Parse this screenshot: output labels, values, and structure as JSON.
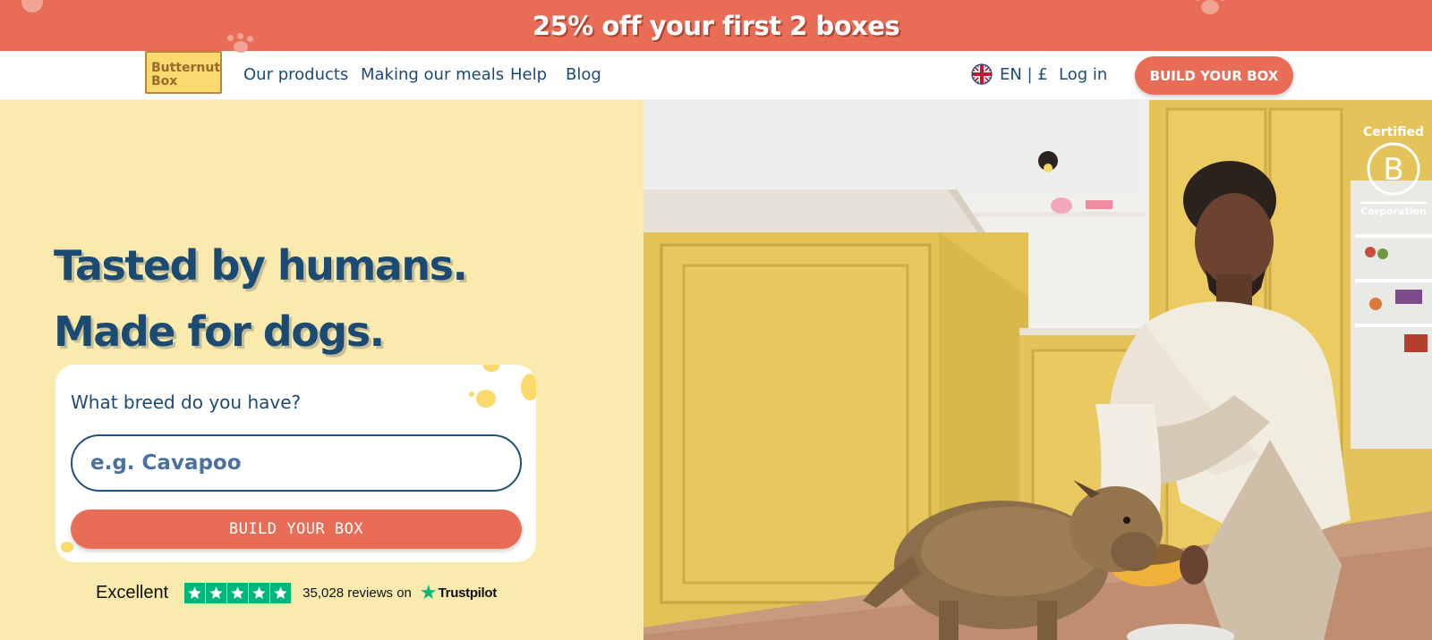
{
  "promo": {
    "text": "25% off your first 2 boxes"
  },
  "nav": {
    "logo_line1": "Butternut",
    "logo_line2": "Box",
    "links": [
      "Our products",
      "Making our meals",
      "Help",
      "Blog"
    ],
    "lang": "EN | £",
    "login": "Log in",
    "build_label": "BUILD YOUR BOX"
  },
  "hero": {
    "headline_line1": "Tasted by humans.",
    "headline_line2": "Made for dogs.",
    "card": {
      "question": "What breed do you have?",
      "placeholder": "e.g. Cavapoo",
      "button": "BUILD YOUR BOX"
    },
    "trustpilot": {
      "rating_word": "Excellent",
      "stars": 5,
      "review_count": "35,028 reviews on",
      "brand": "Trustpilot"
    },
    "bcorp": {
      "top": "Certified",
      "letter": "B",
      "bottom": "Corporation"
    }
  },
  "colors": {
    "coral": "#e96c57",
    "navy": "#1d4a74",
    "cream": "#faeaae",
    "mustard": "#e5c55a",
    "trustpilot_green": "#00b67a"
  }
}
